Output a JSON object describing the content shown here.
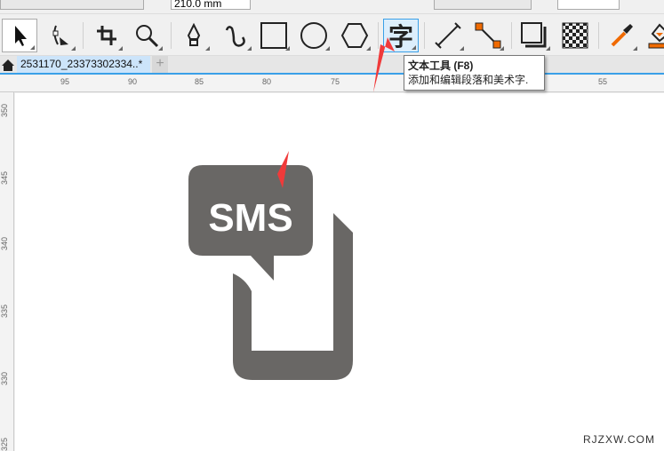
{
  "property_bar": {
    "height_value": "210.0 mm"
  },
  "toolbar": {
    "tools": [
      {
        "name": "pick-tool",
        "icon": "arrow-pointer-icon"
      },
      {
        "name": "shape-tool",
        "icon": "node-edit-icon"
      },
      {
        "name": "crop-tool",
        "icon": "crop-icon"
      },
      {
        "name": "zoom-tool",
        "icon": "magnifier-icon"
      },
      {
        "name": "pen-tool",
        "icon": "pen-nib-icon"
      },
      {
        "name": "artistic-media-tool",
        "icon": "curve-icon"
      },
      {
        "name": "rectangle-tool",
        "icon": "rectangle-icon"
      },
      {
        "name": "ellipse-tool",
        "icon": "ellipse-icon"
      },
      {
        "name": "polygon-tool",
        "icon": "hexagon-icon"
      },
      {
        "name": "text-tool",
        "icon": "text-char-icon",
        "glyph": "字"
      },
      {
        "name": "dimension-tool",
        "icon": "dimension-line-icon"
      },
      {
        "name": "connector-tool",
        "icon": "connector-icon"
      },
      {
        "name": "drop-shadow-tool",
        "icon": "shadow-icon"
      },
      {
        "name": "transparency-tool",
        "icon": "checkerboard-icon"
      },
      {
        "name": "eyedropper-tool",
        "icon": "eyedropper-icon"
      },
      {
        "name": "fill-tool",
        "icon": "fill-icon"
      }
    ]
  },
  "tabs": {
    "document": "2531170_23373302334..*",
    "add": "+"
  },
  "tooltip": {
    "title": "文本工具 (F8)",
    "description": "添加和编辑段落和美术字."
  },
  "hruler": [
    "95",
    "90",
    "85",
    "80",
    "75",
    "55"
  ],
  "vruler": [
    "350",
    "345",
    "340",
    "335",
    "330",
    "325"
  ],
  "canvas": {
    "sms_text": "SMS",
    "icon_color": "#696765"
  },
  "watermark": "RJZXW.COM",
  "colors": {
    "accent": "#3aa0e8",
    "arrow": "#f03a3a"
  }
}
